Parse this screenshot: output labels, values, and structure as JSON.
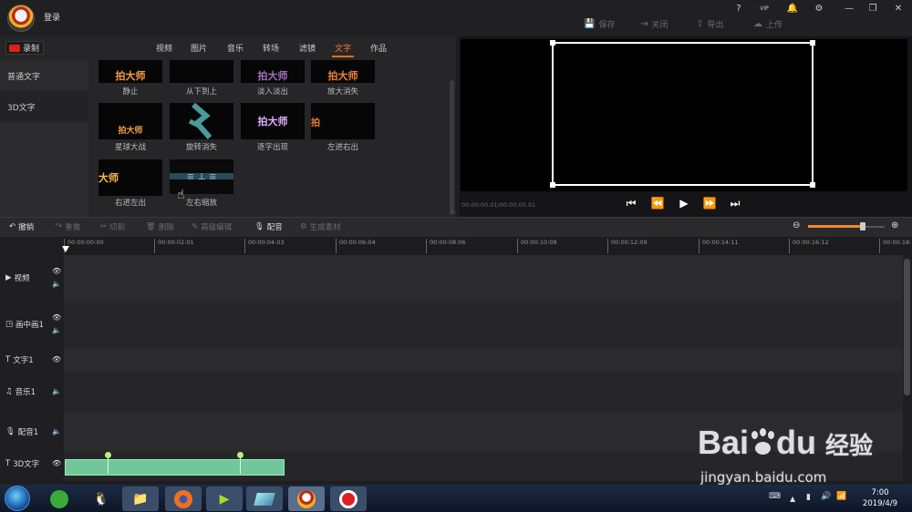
{
  "header": {
    "login": "登录",
    "window_controls": [
      "?",
      "VIP",
      "🔔",
      "⚙",
      "—",
      "❐",
      "✕"
    ],
    "actions": [
      {
        "label": "保存",
        "icon": "save-icon"
      },
      {
        "label": "关闭",
        "icon": "close-doc-icon"
      },
      {
        "label": "导出",
        "icon": "export-icon"
      },
      {
        "label": "上传",
        "icon": "upload-icon"
      }
    ]
  },
  "record": {
    "label": "录制"
  },
  "tabs": [
    {
      "label": "视频",
      "active": false
    },
    {
      "label": "图片",
      "active": false
    },
    {
      "label": "音乐",
      "active": false
    },
    {
      "label": "转场",
      "active": false
    },
    {
      "label": "滤镜",
      "active": false
    },
    {
      "label": "文字",
      "active": true
    },
    {
      "label": "作品",
      "active": false
    }
  ],
  "sidebar": {
    "items": [
      {
        "label": "普通文字",
        "active": false
      },
      {
        "label": "3D文字",
        "active": true
      }
    ]
  },
  "effects": [
    {
      "label": "静止",
      "text": "拍大师",
      "color": "#f5a040"
    },
    {
      "label": "从下到上",
      "text": "",
      "color": "#ffffff"
    },
    {
      "label": "淡入淡出",
      "text": "拍大师",
      "color": "#a070c0"
    },
    {
      "label": "放大消失",
      "text": "拍大师",
      "color": "#f08030"
    },
    {
      "label": "星球大战",
      "text": "拍大师",
      "color": "#f5a040"
    },
    {
      "label": "旋转消失",
      "text": "",
      "color": "#5aa0a0"
    },
    {
      "label": "逐字出现",
      "text": "拍大师",
      "color": "#e0b0ff"
    },
    {
      "label": "左进右出",
      "text": "拍",
      "color": "#f08030"
    },
    {
      "label": "右进左出",
      "text": "大师",
      "color": "#f5c040"
    },
    {
      "label": "左右缩放",
      "text": "",
      "color": "#6ab0d0"
    }
  ],
  "preview": {
    "time": "00:00:00.01/00:00:05.01"
  },
  "toolbar": {
    "items": [
      {
        "label": "撤销",
        "icon": "undo-icon",
        "enabled": true
      },
      {
        "label": "重做",
        "icon": "redo-icon",
        "enabled": false
      },
      {
        "label": "切割",
        "icon": "scissors-icon",
        "enabled": false
      },
      {
        "label": "删除",
        "icon": "trash-icon",
        "enabled": false
      },
      {
        "label": "高级编辑",
        "icon": "pencil-icon",
        "enabled": false
      },
      {
        "label": "配音",
        "icon": "microphone-icon",
        "enabled": true
      },
      {
        "label": "生成素材",
        "icon": "generate-icon",
        "enabled": false
      }
    ],
    "zoom_level": 0.7
  },
  "ruler": [
    "00:00:00:00",
    "00:00:02:01",
    "00:00:04:03",
    "00:00:06:04",
    "00:00:08:06",
    "00:00:10:08",
    "00:00:12:09",
    "00:00:14:11",
    "00:00:16:12",
    "00:00:18:"
  ],
  "tracks": [
    {
      "label": "视频",
      "icon": "video-icon"
    },
    {
      "label": "画中画1",
      "icon": "pip-icon"
    },
    {
      "label": "文字1",
      "icon": "text-icon"
    },
    {
      "label": "音乐1",
      "icon": "music-icon"
    },
    {
      "label": "配音1",
      "icon": "microphone-icon"
    },
    {
      "label": "3D文字",
      "icon": "text-icon"
    }
  ],
  "taskbar": {
    "time": "7:00",
    "date": "2019/4/9"
  },
  "watermark": {
    "brand": "Bai",
    "brand2": "du",
    "cn": "经验",
    "url": "jingyan.baidu.com"
  }
}
